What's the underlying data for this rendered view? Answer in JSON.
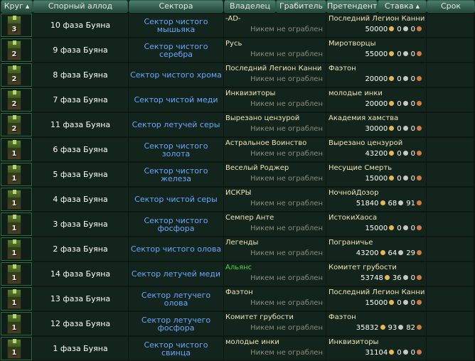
{
  "columns": {
    "round": "Круг",
    "allod": "Спорный аллод",
    "sectors": "Сектора",
    "owner": "Владелец",
    "robber": "Грабитель",
    "claimant": "Претендент",
    "bid": "Ставка",
    "deadline": "Срок"
  },
  "robber_text": "Никем не ограблен",
  "rows": [
    {
      "round": "3",
      "allod": "10 фаза Буяна",
      "sector": "Сектор чистого мышьяка",
      "owner": "-AD-",
      "owner_color": "default",
      "claimant": "Последний Легион Канни",
      "gold": "50000",
      "silver": "0",
      "copper": "0"
    },
    {
      "round": "2",
      "allod": "9 фаза Буяна",
      "sector": "Сектор чистого серебра",
      "owner": "Русь",
      "owner_color": "default",
      "claimant": "Миротворцы",
      "gold": "55000",
      "silver": "0",
      "copper": "0"
    },
    {
      "round": "2",
      "allod": "8 фаза Буяна",
      "sector": "Сектор чистого хрома",
      "owner": "Последний Легион Канни",
      "owner_color": "default",
      "claimant": "Фаэтон",
      "gold": "20000",
      "silver": "0",
      "copper": "0"
    },
    {
      "round": "2",
      "allod": "7 фаза Буяна",
      "sector": "Сектор чистой меди",
      "owner": "Инквизиторы",
      "owner_color": "default",
      "claimant": "молодые инки",
      "gold": "20000",
      "silver": "0",
      "copper": "0"
    },
    {
      "round": "2",
      "allod": "11 фаза Буяна",
      "sector": "Сектор летучей серы",
      "owner": "Вырезано цензурой",
      "owner_color": "default",
      "claimant": "Академия хамства",
      "gold": "30000",
      "silver": "0",
      "copper": "0"
    },
    {
      "round": "1",
      "allod": "6 фаза Буяна",
      "sector": "Сектор чистого золота",
      "owner": "Астральное Воинство",
      "owner_color": "default",
      "claimant": "Вырезано цензурой",
      "gold": "43200",
      "silver": "0",
      "copper": "0"
    },
    {
      "round": "1",
      "allod": "5 фаза Буяна",
      "sector": "Сектор чистого железа",
      "owner": "Веселый Роджер",
      "owner_color": "default",
      "claimant": "Несущие Смерть",
      "gold": "15000",
      "silver": "0",
      "copper": "0"
    },
    {
      "round": "1",
      "allod": "4 фаза Буяна",
      "sector": "Сектор чистой серы",
      "owner": "ИСКРЫ",
      "owner_color": "default",
      "claimant": "НочнойДозор",
      "gold": "51840",
      "silver": "68",
      "copper": "91"
    },
    {
      "round": "1",
      "allod": "3 фаза Буяна",
      "sector": "Сектор чистого фосфора",
      "owner": "Семпер Анте",
      "owner_color": "default",
      "claimant": "ИстокиХаоса",
      "gold": "15000",
      "silver": "0",
      "copper": "0"
    },
    {
      "round": "1",
      "allod": "2 фаза Буяна",
      "sector": "Сектор чистого олова",
      "owner": "Легенды",
      "owner_color": "default",
      "claimant": "Пограничье",
      "gold": "43200",
      "silver": "64",
      "copper": "29"
    },
    {
      "round": "1",
      "allod": "14 фаза Буяна",
      "sector": "Сектор летучей меди",
      "owner": "Альянс",
      "owner_color": "green",
      "claimant": "Комитет грубости",
      "gold": "53748",
      "silver": "36",
      "copper": "0"
    },
    {
      "round": "1",
      "allod": "13 фаза Буяна",
      "sector": "Сектор летучего олова",
      "owner": "Фаэтон",
      "owner_color": "default",
      "claimant": "Последний Легион Канни",
      "gold": "15000",
      "silver": "0",
      "copper": "0"
    },
    {
      "round": "1",
      "allod": "12 фаза Буяна",
      "sector": "Сектор летучего фосфора",
      "owner": "Комитет грубости",
      "owner_color": "default",
      "claimant": "Фаэтон",
      "gold": "35832",
      "silver": "93",
      "copper": "82"
    },
    {
      "round": "1",
      "allod": "1 фаза Буяна",
      "sector": "Сектор чистого свинца",
      "owner": "молодые инки",
      "owner_color": "default",
      "claimant": "Инквизиторы",
      "gold": "31104",
      "silver": "0",
      "copper": "0"
    }
  ]
}
